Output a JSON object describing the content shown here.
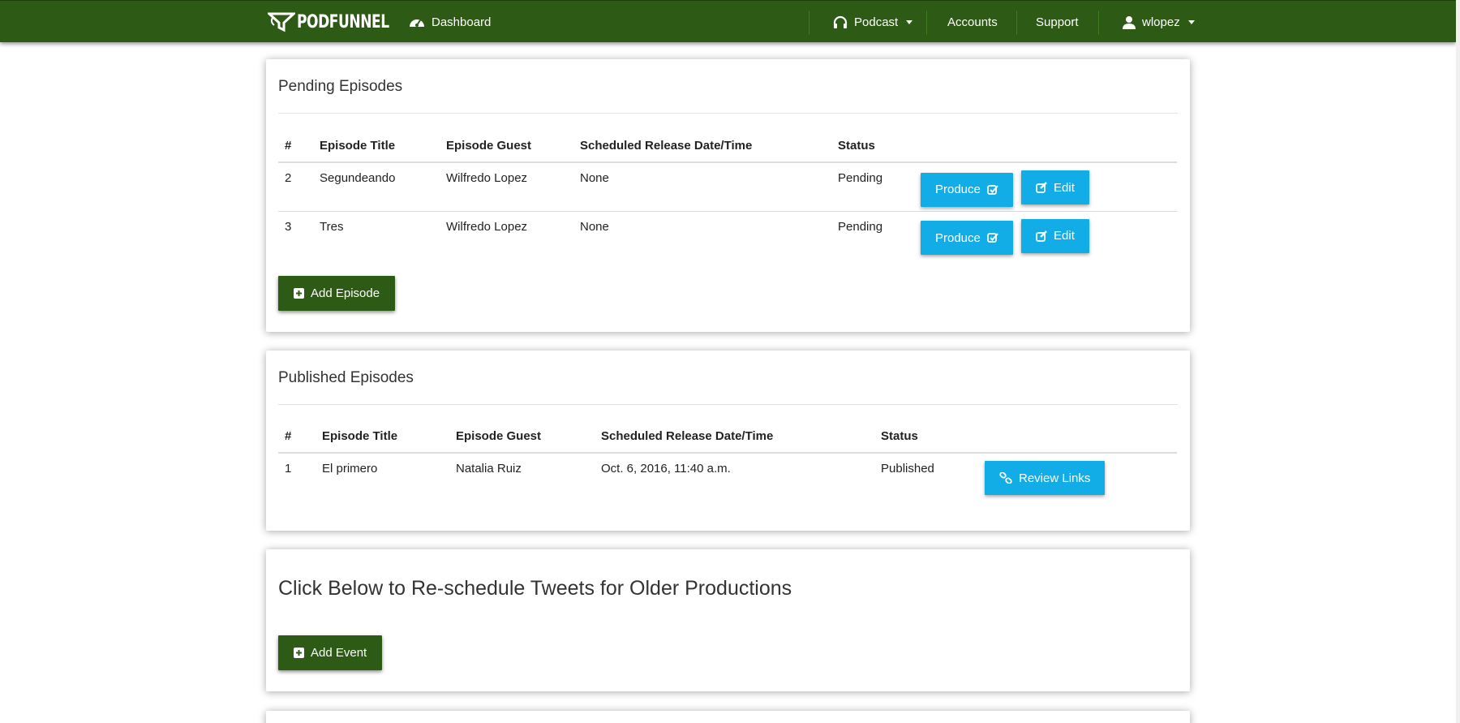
{
  "nav": {
    "brand": "PODFUNNEL",
    "dashboard": "Dashboard",
    "podcast": "Podcast",
    "accounts": "Accounts",
    "support": "Support",
    "user": "wlopez"
  },
  "pending": {
    "title": "Pending Episodes",
    "headers": [
      "#",
      "Episode Title",
      "Episode Guest",
      "Scheduled Release Date/Time",
      "Status"
    ],
    "rows": [
      {
        "num": "2",
        "title": "Segundeando",
        "guest": "Wilfredo Lopez",
        "date": "None",
        "status": "Pending"
      },
      {
        "num": "3",
        "title": "Tres",
        "guest": "Wilfredo Lopez",
        "date": "None",
        "status": "Pending"
      }
    ],
    "produce_label": "Produce",
    "edit_label": "Edit",
    "add_label": "Add Episode"
  },
  "published": {
    "title": "Published Episodes",
    "headers": [
      "#",
      "Episode Title",
      "Episode Guest",
      "Scheduled Release Date/Time",
      "Status"
    ],
    "rows": [
      {
        "num": "1",
        "title": "El primero",
        "guest": "Natalia Ruiz",
        "date": "Oct. 6, 2016, 11:40 a.m.",
        "status": "Published"
      }
    ],
    "review_label": "Review Links"
  },
  "tweets": {
    "title": "Click Below to Re-schedule Tweets for Older Productions",
    "add_label": "Add Event"
  },
  "colors": {
    "nav_green": "#2d5a14",
    "button_blue": "#12ade6"
  }
}
